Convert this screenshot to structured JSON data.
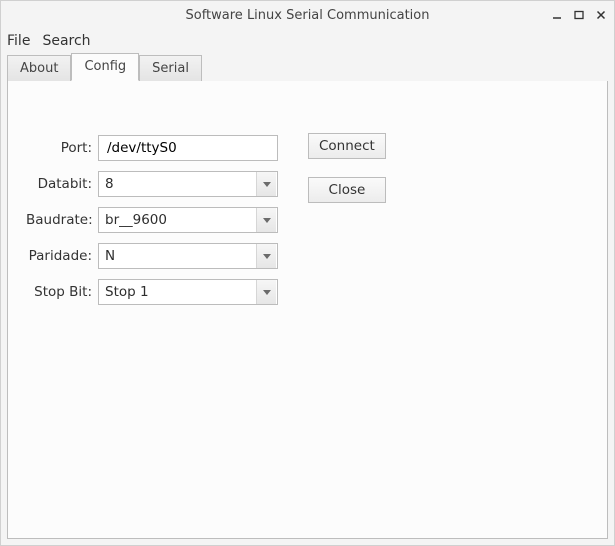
{
  "window": {
    "title": "Software Linux Serial Communication"
  },
  "menubar": {
    "file": "File",
    "search": "Search"
  },
  "tabs": {
    "about": "About",
    "config": "Config",
    "serial": "Serial",
    "active": "config"
  },
  "form": {
    "port": {
      "label": "Port:",
      "value": "/dev/ttyS0"
    },
    "databit": {
      "label": "Databit:",
      "value": "8"
    },
    "baudrate": {
      "label": "Baudrate:",
      "value": "br__9600"
    },
    "paridade": {
      "label": "Paridade:",
      "value": "N"
    },
    "stopbit": {
      "label": "Stop Bit:",
      "value": "Stop 1"
    }
  },
  "buttons": {
    "connect": "Connect",
    "close": "Close"
  }
}
